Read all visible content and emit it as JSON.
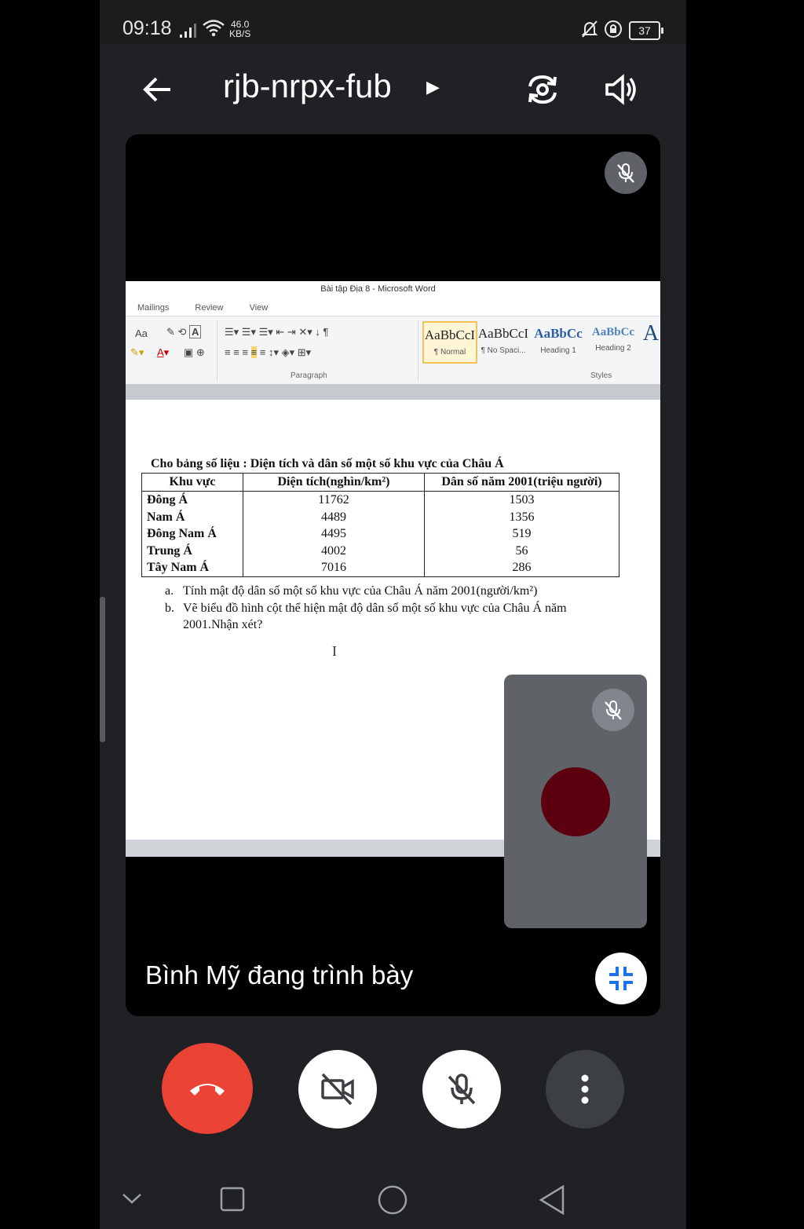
{
  "status_bar": {
    "time": "09:18",
    "net_speed_value": "46.0",
    "net_speed_unit": "KB/S",
    "battery": "37"
  },
  "header": {
    "meeting_code": "rjb-nrpx-fub"
  },
  "word": {
    "window_title": "Bài tập Địa 8  -  Microsoft Word",
    "tabs": [
      "Mailings",
      "Review",
      "View"
    ],
    "group_paragraph": "Paragraph",
    "group_styles": "Styles",
    "font_size_btn": "Aa",
    "styles": [
      {
        "sample": "AaBbCcI",
        "name": "¶ Normal"
      },
      {
        "sample": "AaBbCcI",
        "name": "¶ No Spaci..."
      },
      {
        "sample": "AaBbCc",
        "name": "Heading 1"
      },
      {
        "sample": "AaBbCc",
        "name": "Heading 2"
      },
      {
        "sample": "A",
        "name": ""
      }
    ]
  },
  "document": {
    "heading": "Cho bảng số liệu : Diện tích và dân số một số khu vực của Châu Á",
    "columns": [
      "Khu vực",
      "Diện tích(nghìn/km²)",
      "Dân số năm 2001(triệu người)"
    ],
    "rows": [
      {
        "region": "Đông Á",
        "area": "11762",
        "population": "1503"
      },
      {
        "region": "Nam Á",
        "area": "4489",
        "population": "1356"
      },
      {
        "region": "Đông Nam Á",
        "area": "4495",
        "population": "519"
      },
      {
        "region": "Trung Á",
        "area": "4002",
        "population": "56"
      },
      {
        "region": "Tây Nam Á",
        "area": "7016",
        "population": "286"
      }
    ],
    "question_a_label": "a.",
    "question_a": "Tính mật độ dân số một số khu vực của Châu Á năm 2001(người/km²)",
    "question_b_label": "b.",
    "question_b_line1": "Vẽ biểu đồ hình cột thể hiện mật độ dân số  một số khu vực của Châu Á năm",
    "question_b_line2": "2001.Nhận xét?"
  },
  "presenter": {
    "label": "Bình Mỹ đang trình bày"
  },
  "colors": {
    "hangup": "#ea4335",
    "background": "#202124",
    "avatar": "#5c0010",
    "accent": "#1a73e8"
  }
}
